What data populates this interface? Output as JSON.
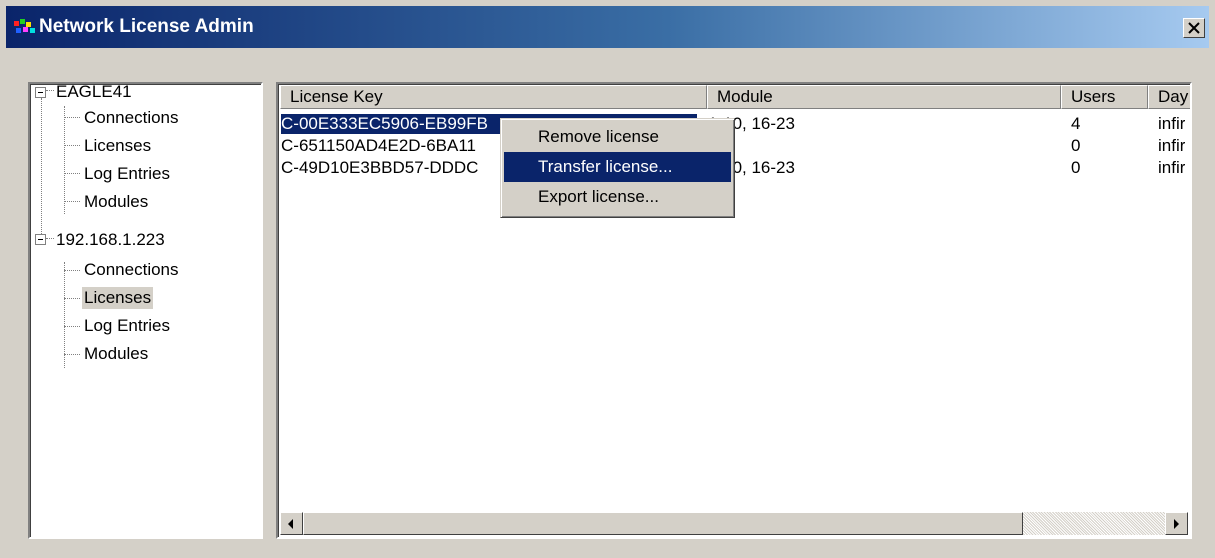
{
  "window": {
    "title": "Network License Admin",
    "close_label": "×"
  },
  "tree": {
    "nodes": [
      {
        "label": "EAGLE41",
        "children": [
          "Connections",
          "Licenses",
          "Log Entries",
          "Modules"
        ]
      },
      {
        "label": "192.168.1.223",
        "children": [
          "Connections",
          "Licenses",
          "Log Entries",
          "Modules"
        ],
        "selected_child": "Licenses"
      }
    ]
  },
  "list": {
    "columns": [
      "License Key",
      "Module",
      "Users",
      "Day"
    ],
    "rows": [
      {
        "key": "C-00E333EC5906-EB99FB",
        "module": "1-10, 16-23",
        "users": "4",
        "days": "infir"
      },
      {
        "key": "C-651150AD4E2D-6BA11",
        "module": "",
        "users": "0",
        "days": "infir"
      },
      {
        "key": "C-49D10E3BBD57-DDDC",
        "module": "1-10, 16-23",
        "users": "0",
        "days": "infir"
      }
    ],
    "selected_row": 0
  },
  "context_menu": {
    "items": [
      "Remove license",
      "Transfer license...",
      "Export license..."
    ],
    "highlighted": 1
  }
}
